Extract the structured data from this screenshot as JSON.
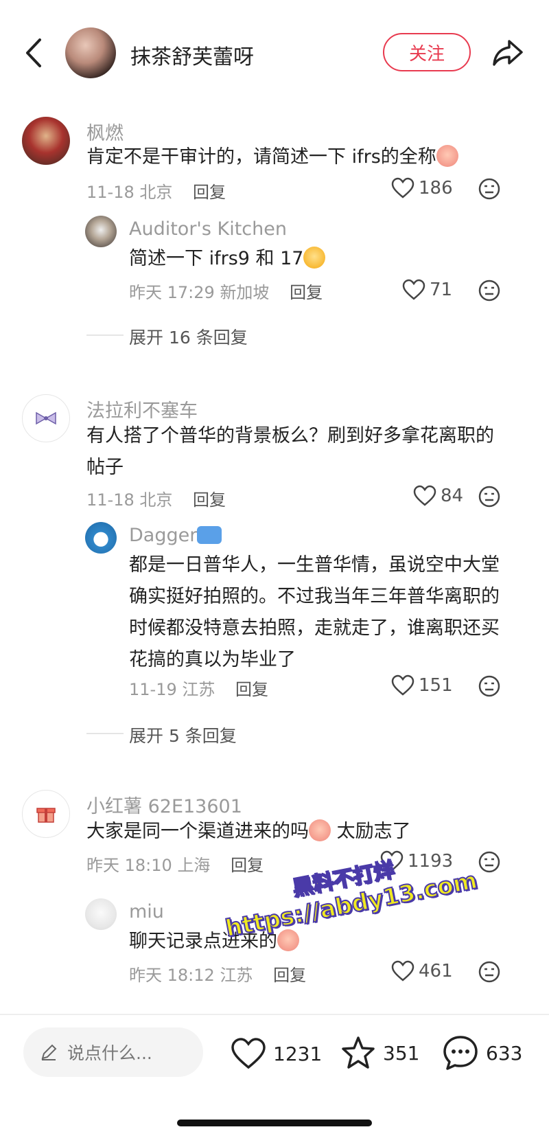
{
  "header": {
    "author": "抹茶舒芙蕾呀",
    "follow_label": "关注"
  },
  "comments": [
    {
      "user": "枫燃",
      "text": "肯定不是干审计的，请简述一下 ifrs的全称",
      "date": "11-18",
      "location": "北京",
      "reply_label": "回复",
      "likes": "186",
      "replies": [
        {
          "user": "Auditor's Kitchen",
          "text": "简述一下 ifrs9 和 17",
          "date": "昨天 17:29",
          "location": "新加坡",
          "reply_label": "回复",
          "likes": "71"
        }
      ],
      "expand": "展开 16 条回复"
    },
    {
      "user": "法拉利不塞车",
      "text_line1": "有人搭了个普华的背景板么？刷到好多拿花离职的",
      "text_line2": "帖子",
      "date": "11-18",
      "location": "北京",
      "reply_label": "回复",
      "likes": "84",
      "replies": [
        {
          "user": "Dagger",
          "text_line1": "都是一日普华人，一生普华情，虽说空中大堂",
          "text_line2": "确实挺好拍照的。不过我当年三年普华离职的",
          "text_line3": "时候都没特意去拍照，走就走了，谁离职还买",
          "text_line4": "花搞的真以为毕业了",
          "date": "11-19",
          "location": "江苏",
          "reply_label": "回复",
          "likes": "151"
        }
      ],
      "expand": "展开 5 条回复"
    },
    {
      "user": "小红薯 62E13601",
      "text_a": "大家是同一个渠道进来的吗",
      "text_b": " 太励志了",
      "date": "昨天 18:10",
      "location": "上海",
      "reply_label": "回复",
      "likes": "1193",
      "replies": [
        {
          "user": "miu",
          "text": "聊天记录点进来的",
          "date": "昨天 18:12",
          "location": "江苏",
          "reply_label": "回复",
          "likes": "461"
        }
      ]
    }
  ],
  "watermark": {
    "line1": "黑料不打烊",
    "line2": "https://abdy13.com"
  },
  "bottom": {
    "placeholder": "说点什么...",
    "likes": "1231",
    "stars": "351",
    "comments": "633"
  }
}
